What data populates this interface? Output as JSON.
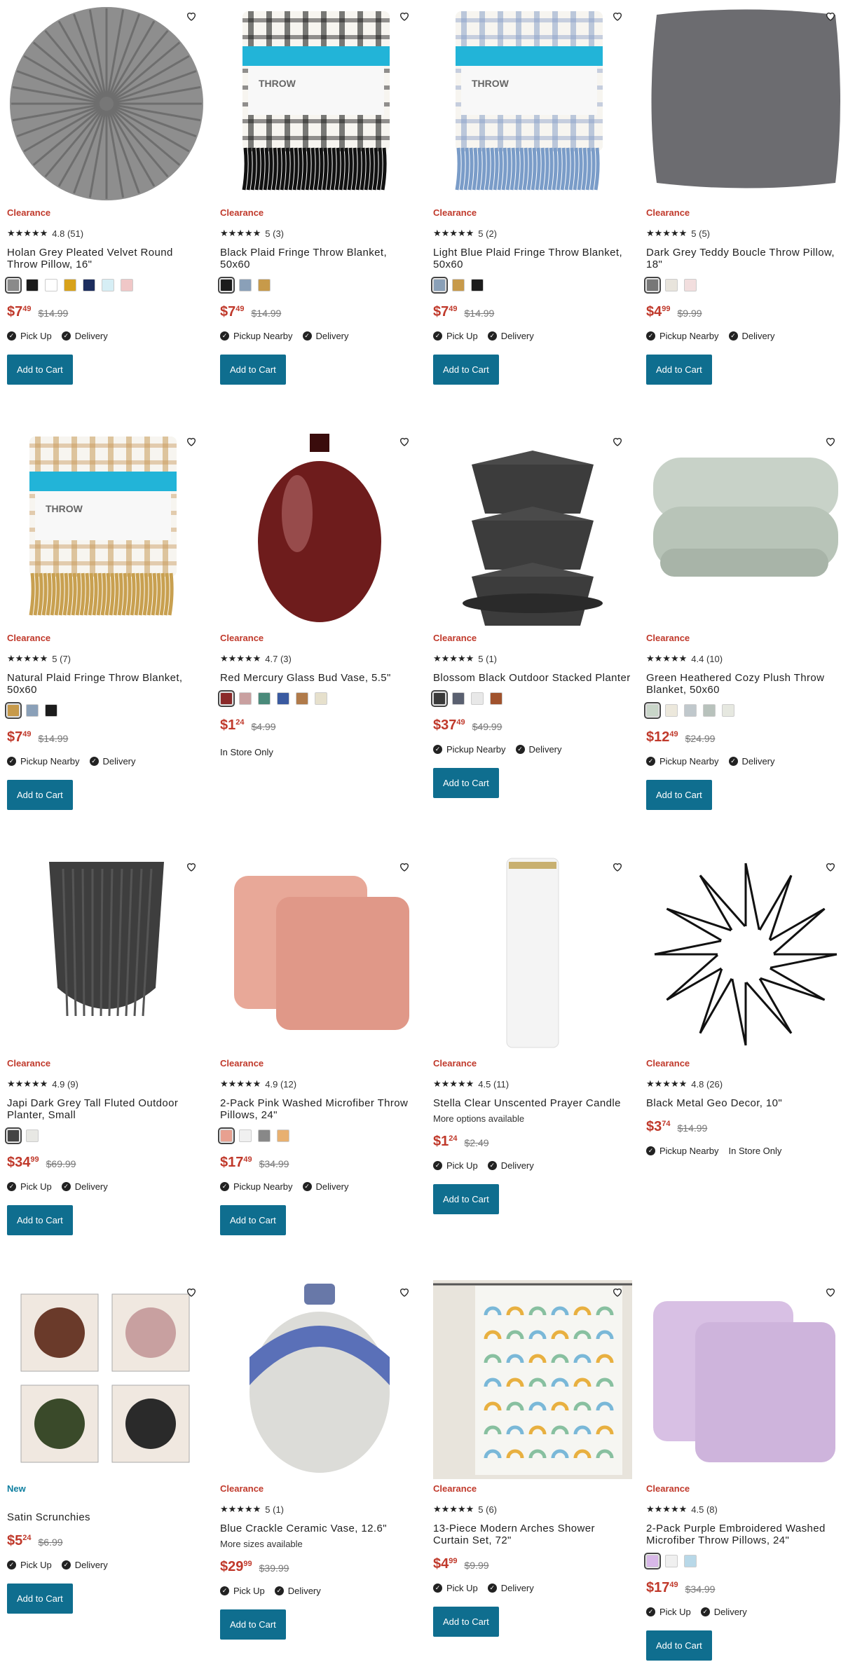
{
  "products": [
    {
      "badge": "Clearance",
      "stars": "★★★★★",
      "rating": "4.8 (51)",
      "title": "Holan Grey Pleated Velvet Round Throw Pillow, 16\"",
      "swatches": [
        "#8a8a8a",
        "#1a1a1a",
        "#ffffff",
        "#d8a21a",
        "#1c2d5e",
        "#d6eef5",
        "#f0c7c7"
      ],
      "price_d": "$7",
      "price_c": "49",
      "was": "$14.99",
      "fulfill": [
        "Pick Up",
        "Delivery"
      ],
      "cta": "Add to Cart",
      "img": "pillow-round"
    },
    {
      "badge": "Clearance",
      "stars": "★★★★★",
      "rating": "5 (3)",
      "title": "Black Plaid Fringe Throw Blanket, 50x60",
      "swatches": [
        "#1c1c1c",
        "#8aa0b8",
        "#c79a4a"
      ],
      "price_d": "$7",
      "price_c": "49",
      "was": "$14.99",
      "fulfill": [
        "Pickup Nearby",
        "Delivery"
      ],
      "cta": "Add to Cart",
      "img": "throw-black",
      "throw_label": "THROW"
    },
    {
      "badge": "Clearance",
      "stars": "★★★★★",
      "rating": "5 (2)",
      "title": "Light Blue Plaid Fringe Throw Blanket, 50x60",
      "swatches": [
        "#8aa0b8",
        "#c79a4a",
        "#1c1c1c"
      ],
      "price_d": "$7",
      "price_c": "49",
      "was": "$14.99",
      "fulfill": [
        "Pick Up",
        "Delivery"
      ],
      "cta": "Add to Cart",
      "img": "throw-blue",
      "throw_label": "THROW"
    },
    {
      "badge": "Clearance",
      "stars": "★★★★★",
      "rating": "5 (5)",
      "title": "Dark Grey Teddy Boucle Throw Pillow, 18\"",
      "swatches": [
        "#777777",
        "#e8e4dc",
        "#f2dede"
      ],
      "price_d": "$4",
      "price_c": "99",
      "was": "$9.99",
      "fulfill": [
        "Pickup Nearby",
        "Delivery"
      ],
      "cta": "Add to Cart",
      "img": "pillow-square"
    },
    {
      "badge": "Clearance",
      "stars": "★★★★★",
      "rating": "5 (7)",
      "title": "Natural Plaid Fringe Throw Blanket, 50x60",
      "swatches": [
        "#c79a4a",
        "#8aa0b8",
        "#1c1c1c"
      ],
      "price_d": "$7",
      "price_c": "49",
      "was": "$14.99",
      "fulfill": [
        "Pickup Nearby",
        "Delivery"
      ],
      "cta": "Add to Cart",
      "img": "throw-natural",
      "throw_label": "THROW"
    },
    {
      "badge": "Clearance",
      "stars": "★★★★★",
      "rating": "4.7 (3)",
      "title": "Red Mercury Glass Bud Vase, 5.5\"",
      "swatches": [
        "#8b2a2a",
        "#c9a0a0",
        "#4a8a7a",
        "#3a5aa0",
        "#b07a4a",
        "#e6e0cc"
      ],
      "price_d": "$1",
      "price_c": "24",
      "was": "$4.99",
      "store_only": "In Store Only",
      "cta": "",
      "img": "vase-red"
    },
    {
      "badge": "Clearance",
      "stars": "★★★★★",
      "rating": "5 (1)",
      "title": "Blossom Black Outdoor Stacked Planter",
      "swatches": [
        "#3a3a3a",
        "#5a6070",
        "#e8e8e8",
        "#a0522d"
      ],
      "price_d": "$37",
      "price_c": "49",
      "was": "$49.99",
      "fulfill": [
        "Pickup Nearby",
        "Delivery"
      ],
      "cta": "Add to Cart",
      "img": "planter-stack"
    },
    {
      "badge": "Clearance",
      "stars": "★★★★★",
      "rating": "4.4 (10)",
      "title": "Green Heathered Cozy Plush Throw Blanket, 50x60",
      "swatches": [
        "#c9d6c9",
        "#ece8dc",
        "#c0c8cc",
        "#b8c2bc",
        "#e6e8e0"
      ],
      "price_d": "$12",
      "price_c": "49",
      "was": "$24.99",
      "fulfill": [
        "Pickup Nearby",
        "Delivery"
      ],
      "cta": "Add to Cart",
      "img": "blanket-green"
    },
    {
      "badge": "Clearance",
      "stars": "★★★★★",
      "rating": "4.9 (9)",
      "title": "Japi Dark Grey Tall Fluted Outdoor Planter, Small",
      "swatches": [
        "#444444",
        "#e8e8e4"
      ],
      "price_d": "$34",
      "price_c": "99",
      "was": "$69.99",
      "fulfill": [
        "Pick Up",
        "Delivery"
      ],
      "cta": "Add to Cart",
      "img": "planter-tall"
    },
    {
      "badge": "Clearance",
      "stars": "★★★★★",
      "rating": "4.9 (12)",
      "title": "2-Pack Pink Washed Microfiber Throw Pillows, 24\"",
      "swatches": [
        "#e8a090",
        "#f0f0f0",
        "#888888",
        "#e8b070"
      ],
      "price_d": "$17",
      "price_c": "49",
      "was": "$34.99",
      "fulfill": [
        "Pickup Nearby",
        "Delivery"
      ],
      "cta": "Add to Cart",
      "img": "pillows-pink"
    },
    {
      "badge": "Clearance",
      "stars": "★★★★★",
      "rating": "4.5 (11)",
      "title": "Stella Clear Unscented Prayer Candle",
      "more": "More options available",
      "price_d": "$1",
      "price_c": "24",
      "was": "$2.49",
      "fulfill": [
        "Pick Up",
        "Delivery"
      ],
      "cta": "Add to Cart",
      "img": "candle"
    },
    {
      "badge": "Clearance",
      "stars": "★★★★★",
      "rating": "4.8 (26)",
      "title": "Black Metal Geo Decor, 10\"",
      "price_d": "$3",
      "price_c": "74",
      "was": "$14.99",
      "fulfill": [
        "Pickup Nearby",
        "In Store Only"
      ],
      "cta": "",
      "img": "geo"
    },
    {
      "badge": "New",
      "stars": "",
      "rating": "",
      "title": "Satin Scrunchies",
      "price_d": "$5",
      "price_c": "24",
      "was": "$6.99",
      "fulfill": [
        "Pick Up",
        "Delivery"
      ],
      "cta": "Add to Cart",
      "img": "scrunchies"
    },
    {
      "badge": "Clearance",
      "stars": "★★★★★",
      "rating": "5 (1)",
      "title": "Blue Crackle Ceramic Vase, 12.6\"",
      "more": "More sizes available",
      "price_d": "$29",
      "price_c": "99",
      "was": "$39.99",
      "fulfill": [
        "Pick Up",
        "Delivery"
      ],
      "cta": "Add to Cart",
      "img": "vase-blue"
    },
    {
      "badge": "Clearance",
      "stars": "★★★★★",
      "rating": "5 (6)",
      "title": "13-Piece Modern Arches Shower Curtain Set, 72\"",
      "price_d": "$4",
      "price_c": "99",
      "was": "$9.99",
      "fulfill": [
        "Pick Up",
        "Delivery"
      ],
      "cta": "Add to Cart",
      "img": "curtain"
    },
    {
      "badge": "Clearance",
      "stars": "★★★★★",
      "rating": "4.5 (8)",
      "title": "2-Pack Purple Embroidered Washed Microfiber Throw Pillows, 24\"",
      "swatches": [
        "#d8b8e8",
        "#f0f0f0",
        "#b8d8e8"
      ],
      "price_d": "$17",
      "price_c": "49",
      "was": "$34.99",
      "fulfill": [
        "Pick Up",
        "Delivery"
      ],
      "cta": "Add to Cart",
      "img": "pillows-purple"
    }
  ]
}
